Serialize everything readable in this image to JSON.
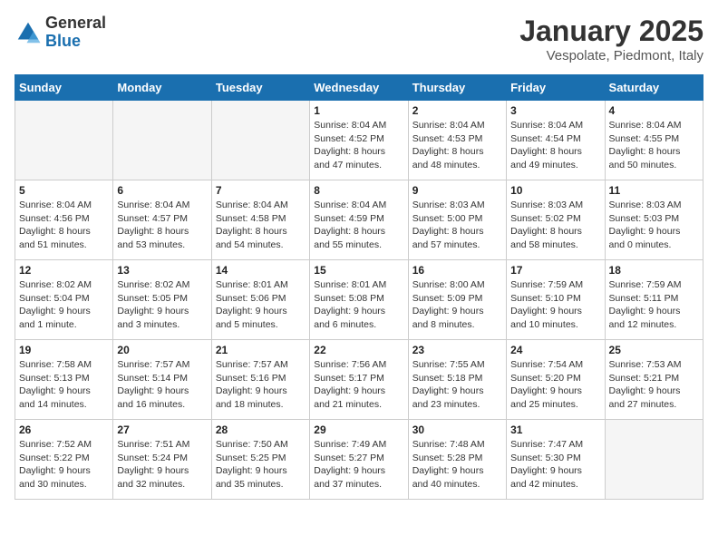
{
  "logo": {
    "general": "General",
    "blue": "Blue"
  },
  "header": {
    "title": "January 2025",
    "subtitle": "Vespolate, Piedmont, Italy"
  },
  "weekdays": [
    "Sunday",
    "Monday",
    "Tuesday",
    "Wednesday",
    "Thursday",
    "Friday",
    "Saturday"
  ],
  "weeks": [
    [
      {
        "day": "",
        "info": ""
      },
      {
        "day": "",
        "info": ""
      },
      {
        "day": "",
        "info": ""
      },
      {
        "day": "1",
        "info": "Sunrise: 8:04 AM\nSunset: 4:52 PM\nDaylight: 8 hours\nand 47 minutes."
      },
      {
        "day": "2",
        "info": "Sunrise: 8:04 AM\nSunset: 4:53 PM\nDaylight: 8 hours\nand 48 minutes."
      },
      {
        "day": "3",
        "info": "Sunrise: 8:04 AM\nSunset: 4:54 PM\nDaylight: 8 hours\nand 49 minutes."
      },
      {
        "day": "4",
        "info": "Sunrise: 8:04 AM\nSunset: 4:55 PM\nDaylight: 8 hours\nand 50 minutes."
      }
    ],
    [
      {
        "day": "5",
        "info": "Sunrise: 8:04 AM\nSunset: 4:56 PM\nDaylight: 8 hours\nand 51 minutes."
      },
      {
        "day": "6",
        "info": "Sunrise: 8:04 AM\nSunset: 4:57 PM\nDaylight: 8 hours\nand 53 minutes."
      },
      {
        "day": "7",
        "info": "Sunrise: 8:04 AM\nSunset: 4:58 PM\nDaylight: 8 hours\nand 54 minutes."
      },
      {
        "day": "8",
        "info": "Sunrise: 8:04 AM\nSunset: 4:59 PM\nDaylight: 8 hours\nand 55 minutes."
      },
      {
        "day": "9",
        "info": "Sunrise: 8:03 AM\nSunset: 5:00 PM\nDaylight: 8 hours\nand 57 minutes."
      },
      {
        "day": "10",
        "info": "Sunrise: 8:03 AM\nSunset: 5:02 PM\nDaylight: 8 hours\nand 58 minutes."
      },
      {
        "day": "11",
        "info": "Sunrise: 8:03 AM\nSunset: 5:03 PM\nDaylight: 9 hours\nand 0 minutes."
      }
    ],
    [
      {
        "day": "12",
        "info": "Sunrise: 8:02 AM\nSunset: 5:04 PM\nDaylight: 9 hours\nand 1 minute."
      },
      {
        "day": "13",
        "info": "Sunrise: 8:02 AM\nSunset: 5:05 PM\nDaylight: 9 hours\nand 3 minutes."
      },
      {
        "day": "14",
        "info": "Sunrise: 8:01 AM\nSunset: 5:06 PM\nDaylight: 9 hours\nand 5 minutes."
      },
      {
        "day": "15",
        "info": "Sunrise: 8:01 AM\nSunset: 5:08 PM\nDaylight: 9 hours\nand 6 minutes."
      },
      {
        "day": "16",
        "info": "Sunrise: 8:00 AM\nSunset: 5:09 PM\nDaylight: 9 hours\nand 8 minutes."
      },
      {
        "day": "17",
        "info": "Sunrise: 7:59 AM\nSunset: 5:10 PM\nDaylight: 9 hours\nand 10 minutes."
      },
      {
        "day": "18",
        "info": "Sunrise: 7:59 AM\nSunset: 5:11 PM\nDaylight: 9 hours\nand 12 minutes."
      }
    ],
    [
      {
        "day": "19",
        "info": "Sunrise: 7:58 AM\nSunset: 5:13 PM\nDaylight: 9 hours\nand 14 minutes."
      },
      {
        "day": "20",
        "info": "Sunrise: 7:57 AM\nSunset: 5:14 PM\nDaylight: 9 hours\nand 16 minutes."
      },
      {
        "day": "21",
        "info": "Sunrise: 7:57 AM\nSunset: 5:16 PM\nDaylight: 9 hours\nand 18 minutes."
      },
      {
        "day": "22",
        "info": "Sunrise: 7:56 AM\nSunset: 5:17 PM\nDaylight: 9 hours\nand 21 minutes."
      },
      {
        "day": "23",
        "info": "Sunrise: 7:55 AM\nSunset: 5:18 PM\nDaylight: 9 hours\nand 23 minutes."
      },
      {
        "day": "24",
        "info": "Sunrise: 7:54 AM\nSunset: 5:20 PM\nDaylight: 9 hours\nand 25 minutes."
      },
      {
        "day": "25",
        "info": "Sunrise: 7:53 AM\nSunset: 5:21 PM\nDaylight: 9 hours\nand 27 minutes."
      }
    ],
    [
      {
        "day": "26",
        "info": "Sunrise: 7:52 AM\nSunset: 5:22 PM\nDaylight: 9 hours\nand 30 minutes."
      },
      {
        "day": "27",
        "info": "Sunrise: 7:51 AM\nSunset: 5:24 PM\nDaylight: 9 hours\nand 32 minutes."
      },
      {
        "day": "28",
        "info": "Sunrise: 7:50 AM\nSunset: 5:25 PM\nDaylight: 9 hours\nand 35 minutes."
      },
      {
        "day": "29",
        "info": "Sunrise: 7:49 AM\nSunset: 5:27 PM\nDaylight: 9 hours\nand 37 minutes."
      },
      {
        "day": "30",
        "info": "Sunrise: 7:48 AM\nSunset: 5:28 PM\nDaylight: 9 hours\nand 40 minutes."
      },
      {
        "day": "31",
        "info": "Sunrise: 7:47 AM\nSunset: 5:30 PM\nDaylight: 9 hours\nand 42 minutes."
      },
      {
        "day": "",
        "info": ""
      }
    ]
  ]
}
